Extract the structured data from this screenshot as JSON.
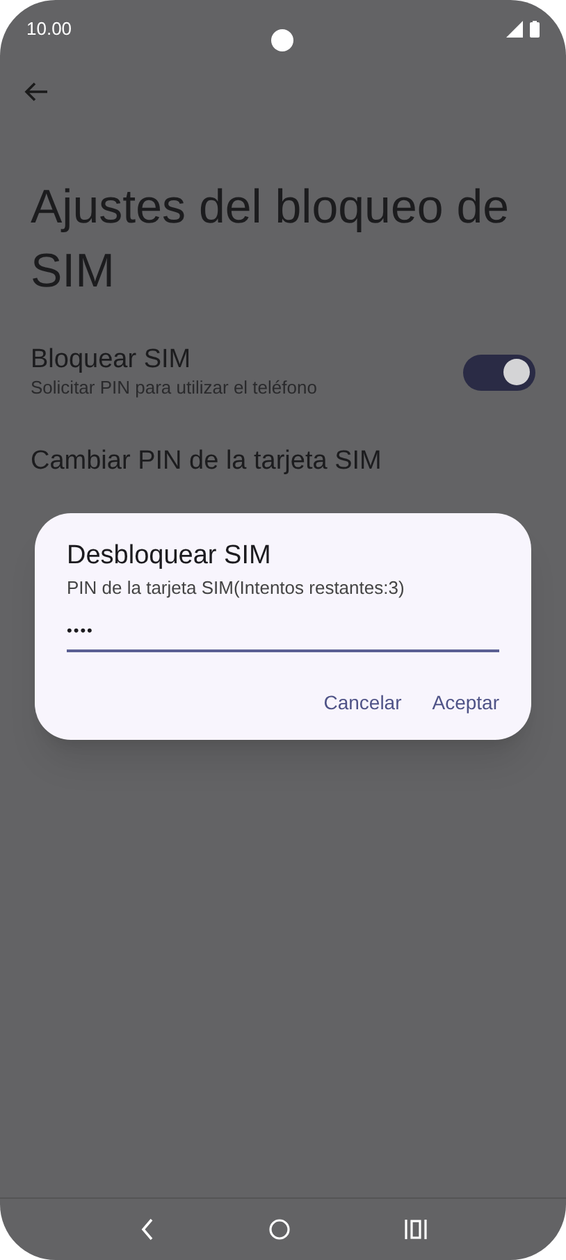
{
  "status_bar": {
    "time": "10.00"
  },
  "title": "Ajustes del bloqueo de SIM",
  "settings": [
    {
      "kind": "toggle",
      "title": "Bloquear SIM",
      "subtitle": "Solicitar PIN para utilizar el teléfono",
      "on": true
    },
    {
      "kind": "plain",
      "title": "Cambiar PIN de la tarjeta SIM"
    }
  ],
  "dialog": {
    "title": "Desbloquear SIM",
    "message": "PIN de la tarjeta SIM(Intentos restantes:3)",
    "value": "••••",
    "buttons": [
      "Cancelar",
      "Aceptar"
    ]
  }
}
